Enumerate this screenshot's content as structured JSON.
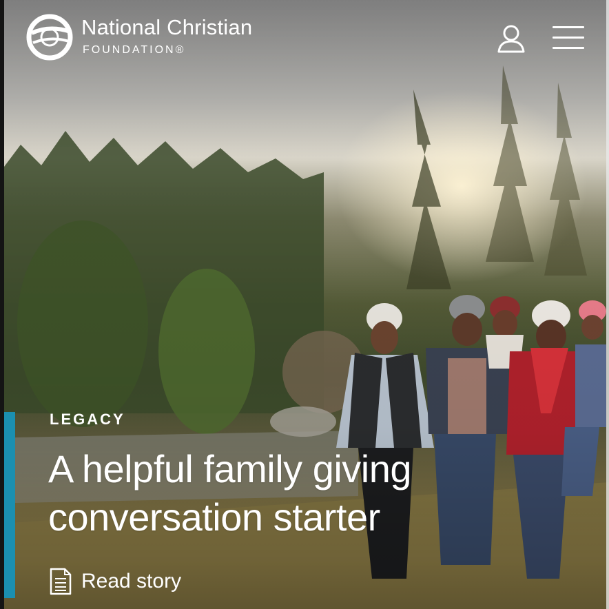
{
  "header": {
    "brand_name": "National Christian",
    "brand_sub": "FOUNDATION®",
    "logo_icon": "ncf-logo-icon",
    "user_icon": "user-icon",
    "menu_icon": "hamburger-menu-icon"
  },
  "hero": {
    "category": "LEGACY",
    "title": "A helpful family giving conversation starter",
    "link_label": "Read story",
    "link_icon": "document-icon",
    "accent_color": "#1b8fb0"
  }
}
